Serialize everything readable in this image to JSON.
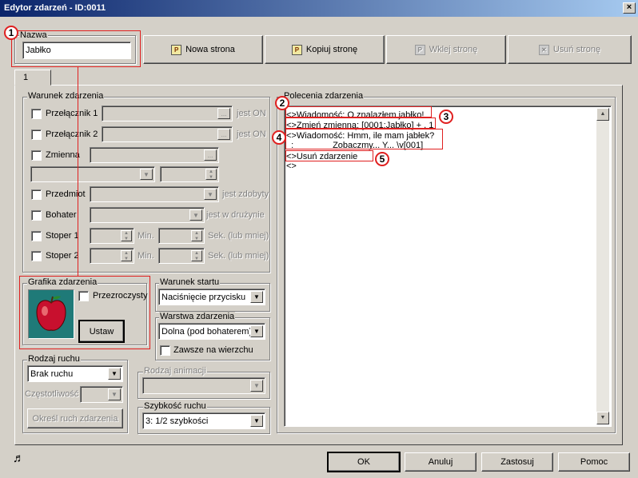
{
  "window": {
    "title": "Edytor zdarzeń - ID:0011",
    "close": "×"
  },
  "name": {
    "label": "Nazwa",
    "value": "Jabłko"
  },
  "toolbar": {
    "new": "Nowa strona",
    "copy": "Kopiuj stronę",
    "paste": "Wklej stronę",
    "delete": "Usuń stronę"
  },
  "tabs": [
    "1"
  ],
  "conditions": {
    "title": "Warunek zdarzenia",
    "switch1": "Przełącznik 1",
    "switch2": "Przełącznik 2",
    "is_on": "jest ON",
    "variable": "Zmienna",
    "item": "Przedmiot",
    "item_suffix": "jest zdobyty",
    "hero": "Bohater",
    "hero_suffix": "jest w drużynie",
    "timer1": "Stoper 1",
    "timer2": "Stoper 2",
    "min": "Min.",
    "sec": "Sek. (lub mniej)",
    "dots": "..."
  },
  "graphic": {
    "title": "Grafika zdarzenia",
    "transparent": "Przezroczysty",
    "set": "Ustaw"
  },
  "start": {
    "title": "Warunek startu",
    "value": "Naciśnięcie przycisku"
  },
  "layer": {
    "title": "Warstwa zdarzenia",
    "value": "Dolna (pod bohaterem)",
    "always_top": "Zawsze na wierzchu"
  },
  "movement": {
    "title": "Rodzaj ruchu",
    "value": "Brak ruchu",
    "frequency": "Częstotliwość",
    "define": "Określ ruch zdarzenia"
  },
  "animation": {
    "title": "Rodzaj animacji"
  },
  "speed": {
    "title": "Szybkość ruchu",
    "value": "3: 1/2 szybkości"
  },
  "commands": {
    "title": "Polecenia zdarzenia",
    "lines": [
      "<>Wiadomość: O znalazłem jabłko!",
      "<>Zmień zmienną: [0001:Jabłko] + , 1",
      "<>Wiadomość: Hmm, ile mam jabłek?",
      "  :                Zobaczmy... Y... \\v[001]",
      "<>Usuń zdarzenie",
      "<>"
    ]
  },
  "markers": [
    "1",
    "2",
    "3",
    "4",
    "5"
  ],
  "footer": {
    "ok": "OK",
    "cancel": "Anuluj",
    "apply": "Zastosuj",
    "help": "Pomoc",
    "music_icon": "♬"
  }
}
